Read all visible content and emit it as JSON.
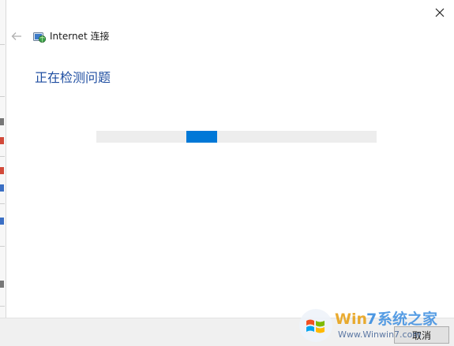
{
  "window": {
    "title": "Internet 连接",
    "icons": {
      "close": "close-icon",
      "back": "back-arrow-icon",
      "app": "network-globe-icon"
    }
  },
  "main": {
    "heading": "正在检测问题",
    "progress": {
      "indeterminate": true,
      "chunk_start_fraction": 0.32,
      "chunk_width_fraction": 0.11
    }
  },
  "footer": {
    "cancel_label": "取消"
  },
  "watermark": {
    "brand": "Win7系统之家",
    "url": "Www.Winwin7.com"
  },
  "colors": {
    "accent": "#0078d7",
    "heading": "#1f4ea1",
    "track": "#ededed"
  }
}
